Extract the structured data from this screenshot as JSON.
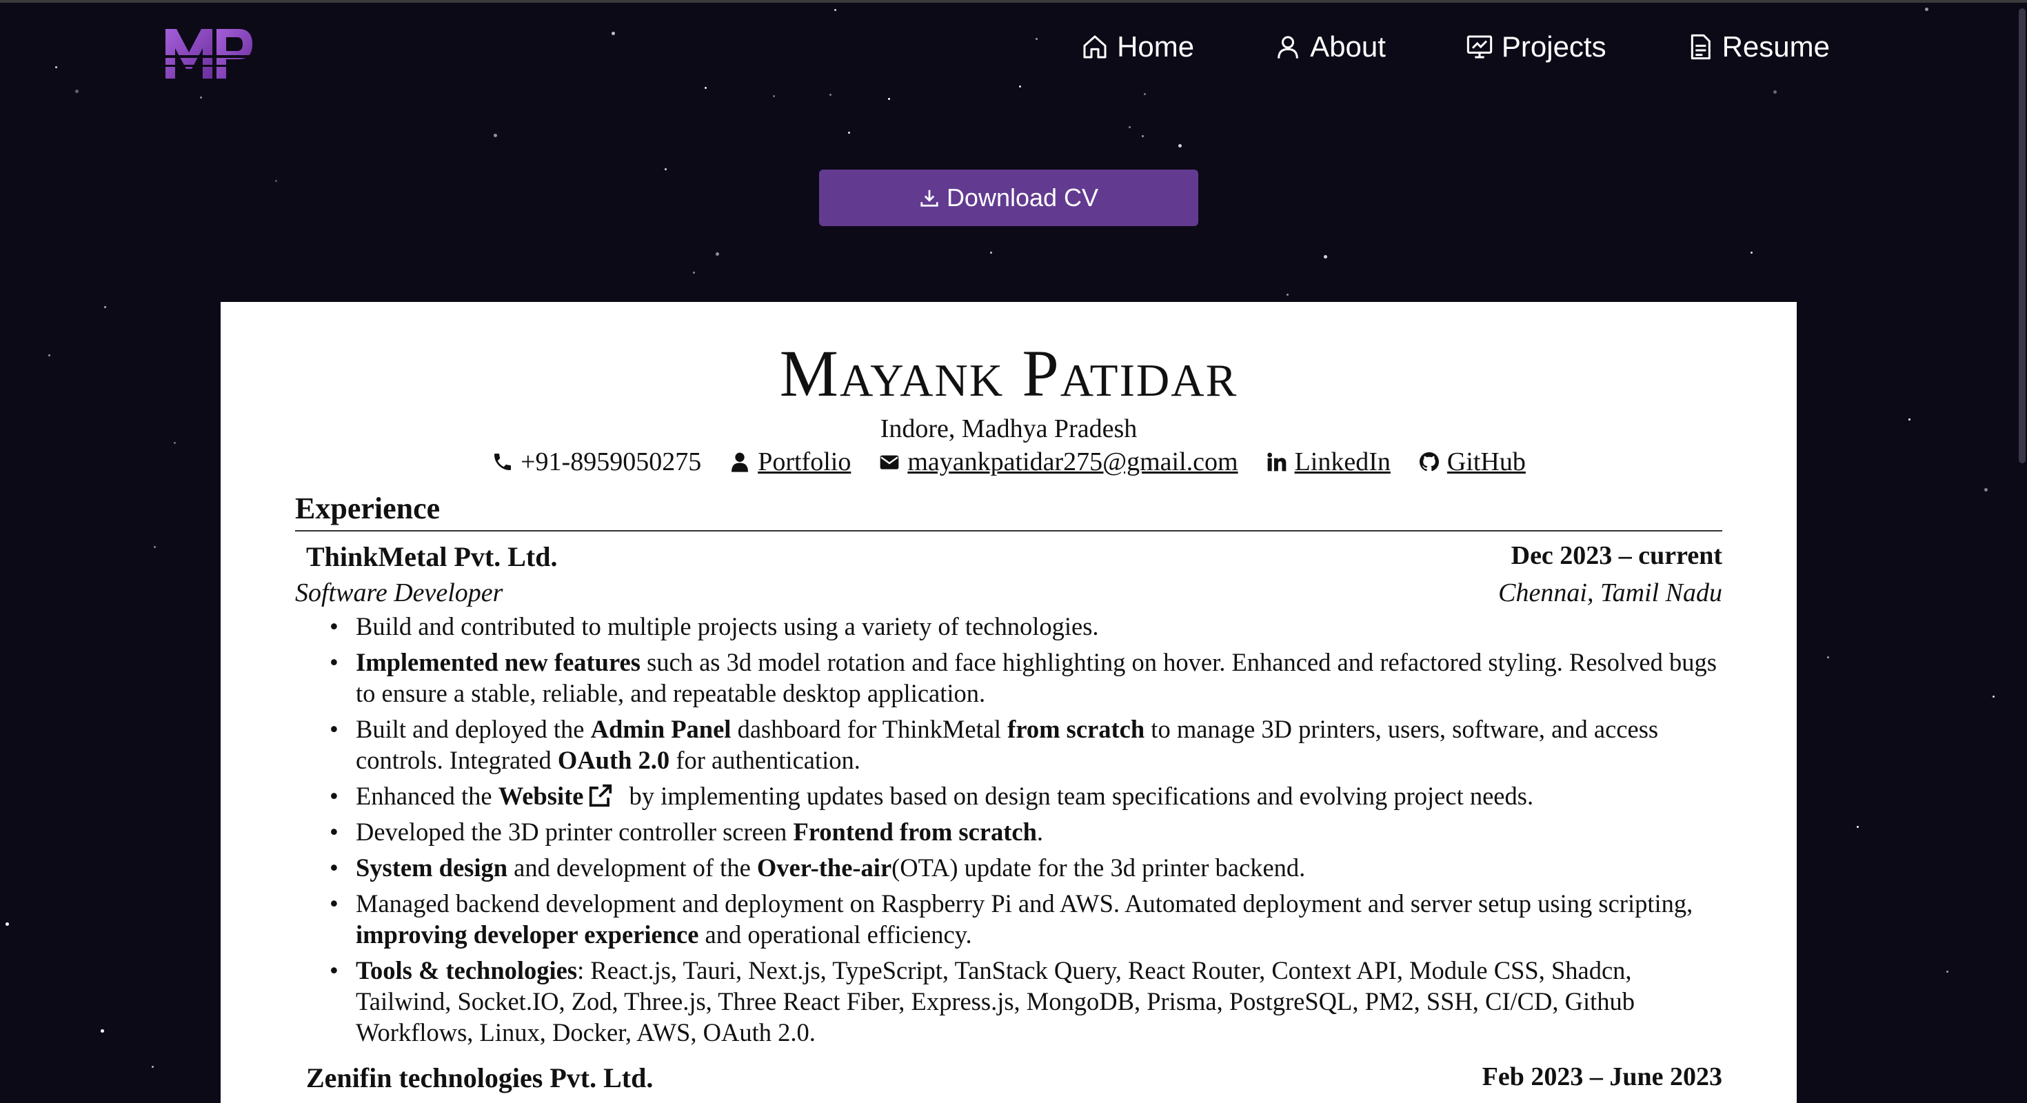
{
  "logo": {
    "text": "MP",
    "accent": "#8e4fc4"
  },
  "nav": [
    {
      "label": "Home",
      "icon": "home-icon"
    },
    {
      "label": "About",
      "icon": "user-icon"
    },
    {
      "label": "Projects",
      "icon": "presentation-icon"
    },
    {
      "label": "Resume",
      "icon": "document-icon"
    }
  ],
  "download": {
    "label": "Download CV",
    "icon": "download-icon",
    "color": "#623b91"
  },
  "resume": {
    "name": "Mayank Patidar",
    "location": "Indore, Madhya Pradesh",
    "phone": "+91-8959050275",
    "portfolio": "Portfolio",
    "email": "mayankpatidar275@gmail.com",
    "linkedin": "LinkedIn",
    "github": "GitHub",
    "section": "Experience",
    "jobs": [
      {
        "company": "ThinkMetal Pvt. Ltd.",
        "dates": "Dec 2023 – current",
        "role": "Software Developer",
        "place": "Chennai, Tamil Nadu"
      },
      {
        "company": "Zenifin technologies Pvt. Ltd.",
        "dates": "Feb 2023 – June 2023"
      }
    ],
    "bullets": {
      "b1": "Build and contributed to multiple projects using a variety of technologies.",
      "b2_bold": "Implemented new features",
      "b2_rest": " such as 3d model rotation and face highlighting on hover. Enhanced and refactored styling. Resolved bugs to ensure a stable, reliable, and repeatable desktop application.",
      "b3_a": "Built and deployed the ",
      "b3_bold1": "Admin Panel",
      "b3_b": " dashboard for ThinkMetal ",
      "b3_bold2": "from scratch",
      "b3_c": " to manage 3D printers, users, software, and access controls. Integrated ",
      "b3_bold3": "OAuth 2.0",
      "b3_d": " for authentication.",
      "b4_a": "Enhanced the ",
      "b4_bold": "Website",
      "b4_b": "by implementing updates based on design team specifications and evolving project needs.",
      "b5_a": "Developed the 3D printer controller screen ",
      "b5_bold": "Frontend from scratch",
      "b5_b": ".",
      "b6_bold1": "System design",
      "b6_a": " and development of the ",
      "b6_bold2": "Over-the-air",
      "b6_b": "(OTA) update for the 3d printer backend.",
      "b7_a": "Managed backend development and deployment on Raspberry Pi and AWS. Automated deployment and server setup using scripting, ",
      "b7_bold": "improving developer experience",
      "b7_b": " and operational efficiency.",
      "b8_bold": "Tools & technologies",
      "b8_rest": ": React.js, Tauri, Next.js, TypeScript, TanStack Query, React Router, Context API, Module CSS, Shadcn, Tailwind, Socket.IO, Zod, Three.js, Three React Fiber, Express.js, MongoDB, Prisma, PostgreSQL, PM2, SSH, CI/CD, Github Workflows, Linux, Docker, AWS, OAuth 2.0."
    }
  }
}
